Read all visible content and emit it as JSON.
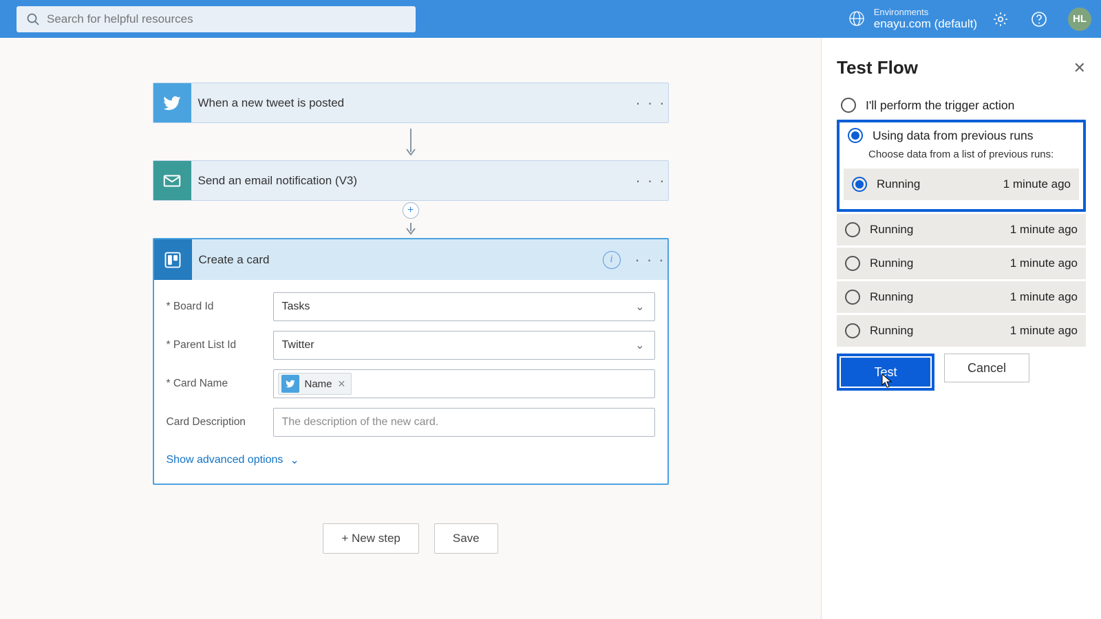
{
  "header": {
    "search_placeholder": "Search for helpful resources",
    "env_label": "Environments",
    "env_name": "enayu.com (default)",
    "avatar_initials": "HL"
  },
  "flow": {
    "steps": [
      {
        "title": "When a new tweet is posted"
      },
      {
        "title": "Send an email notification (V3)"
      }
    ],
    "card": {
      "title": "Create a card",
      "fields": {
        "board_label": "* Board Id",
        "board_value": "Tasks",
        "list_label": "* Parent List Id",
        "list_value": "Twitter",
        "name_label": "* Card Name",
        "name_token": "Name",
        "desc_label": "Card Description",
        "desc_placeholder": "The description of the new card."
      },
      "advanced_link": "Show advanced options"
    },
    "new_step_btn": "+ New step",
    "save_btn": "Save"
  },
  "panel": {
    "title": "Test Flow",
    "opt_manual": "I'll perform the trigger action",
    "opt_previous": "Using data from previous runs",
    "opt_previous_sub": "Choose data from a list of previous runs:",
    "runs": [
      {
        "status": "Running",
        "time": "1 minute ago",
        "selected": true
      },
      {
        "status": "Running",
        "time": "1 minute ago",
        "selected": false
      },
      {
        "status": "Running",
        "time": "1 minute ago",
        "selected": false
      },
      {
        "status": "Running",
        "time": "1 minute ago",
        "selected": false
      },
      {
        "status": "Running",
        "time": "1 minute ago",
        "selected": false
      }
    ],
    "test_btn": "Test",
    "cancel_btn": "Cancel"
  }
}
